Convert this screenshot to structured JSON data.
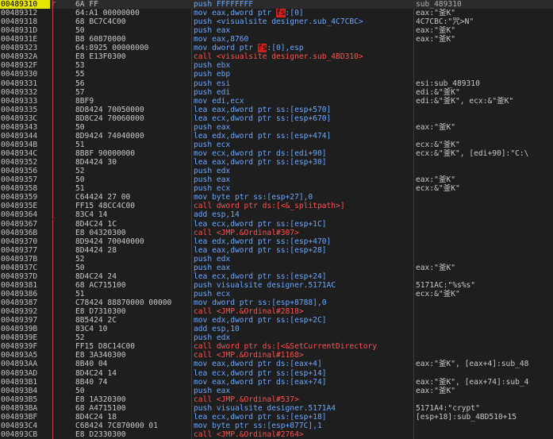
{
  "window": {
    "selected_address": "00489310",
    "function_label": "sub_489310"
  },
  "rows": [
    {
      "addr": "00489310",
      "mk": "tip",
      "bytes": "6A FF",
      "d": [
        [
          "b",
          "push FFFFFFFF"
        ]
      ],
      "cm": "sub_489310",
      "sel": true
    },
    {
      "addr": "00489312",
      "bytes": "64:A1 00000000",
      "d": [
        [
          "b",
          "mov eax,dword ptr "
        ],
        [
          "fs",
          "fs"
        ],
        [
          "b",
          ":[0]"
        ]
      ],
      "cm": "eax:\"釜K\""
    },
    {
      "addr": "00489318",
      "bytes": "68 BC7C4C00",
      "d": [
        [
          "b",
          "push <visualsite designer.sub_4C7CBC>"
        ]
      ],
      "cm": "4C7CBC:\"咒>N\""
    },
    {
      "addr": "0048931D",
      "bytes": "50",
      "d": [
        [
          "b",
          "push eax"
        ]
      ],
      "cm": "eax:\"釜K\""
    },
    {
      "addr": "0048931E",
      "bytes": "B8 60870000",
      "d": [
        [
          "b",
          "mov eax,8760"
        ]
      ],
      "cm": "eax:\"釜K\""
    },
    {
      "addr": "00489323",
      "bytes": "64:8925 00000000",
      "d": [
        [
          "b",
          "mov dword ptr "
        ],
        [
          "fs",
          "fs"
        ],
        [
          "b",
          ":[0],esp"
        ]
      ],
      "cm": ""
    },
    {
      "addr": "0048932A",
      "bytes": "E8 E13F0300",
      "d": [
        [
          "r",
          "call <visualsite designer.sub_4BD310>"
        ]
      ],
      "cm": ""
    },
    {
      "addr": "0048932F",
      "bytes": "53",
      "d": [
        [
          "b",
          "push ebx"
        ]
      ],
      "cm": ""
    },
    {
      "addr": "00489330",
      "bytes": "55",
      "d": [
        [
          "b",
          "push ebp"
        ]
      ],
      "cm": ""
    },
    {
      "addr": "00489331",
      "bytes": "56",
      "d": [
        [
          "b",
          "push esi"
        ]
      ],
      "cm": "esi:sub_489310"
    },
    {
      "addr": "00489332",
      "bytes": "57",
      "d": [
        [
          "b",
          "push edi"
        ]
      ],
      "cm": "edi:&\"釜K\""
    },
    {
      "addr": "00489333",
      "bytes": "8BF9",
      "d": [
        [
          "b",
          "mov edi,ecx"
        ]
      ],
      "cm": "edi:&\"釜K\", ecx:&\"釜K\""
    },
    {
      "addr": "00489335",
      "bytes": "8D8424 70050000",
      "d": [
        [
          "b",
          "lea eax,dword ptr ss:[esp+570]"
        ]
      ],
      "cm": ""
    },
    {
      "addr": "0048933C",
      "bytes": "8D8C24 70060000",
      "d": [
        [
          "b",
          "lea ecx,dword ptr ss:[esp+670]"
        ]
      ],
      "cm": ""
    },
    {
      "addr": "00489343",
      "bytes": "50",
      "d": [
        [
          "b",
          "push eax"
        ]
      ],
      "cm": "eax:\"釜K\""
    },
    {
      "addr": "00489344",
      "bytes": "8D9424 74040000",
      "d": [
        [
          "b",
          "lea edx,dword ptr ss:[esp+474]"
        ]
      ],
      "cm": ""
    },
    {
      "addr": "0048934B",
      "bytes": "51",
      "d": [
        [
          "b",
          "push ecx"
        ]
      ],
      "cm": "ecx:&\"釜K\""
    },
    {
      "addr": "0048934C",
      "bytes": "8B8F 90000000",
      "d": [
        [
          "b",
          "mov ecx,dword ptr ds:[edi+90]"
        ]
      ],
      "cm": "ecx:&\"釜K\", [edi+90]:\"C:\\"
    },
    {
      "addr": "00489352",
      "bytes": "8D4424 30",
      "d": [
        [
          "b",
          "lea eax,dword ptr ss:[esp+30]"
        ]
      ],
      "cm": ""
    },
    {
      "addr": "00489356",
      "bytes": "52",
      "d": [
        [
          "b",
          "push edx"
        ]
      ],
      "cm": ""
    },
    {
      "addr": "00489357",
      "bytes": "50",
      "d": [
        [
          "b",
          "push eax"
        ]
      ],
      "cm": "eax:\"釜K\""
    },
    {
      "addr": "00489358",
      "bytes": "51",
      "d": [
        [
          "b",
          "push ecx"
        ]
      ],
      "cm": "ecx:&\"釜K\""
    },
    {
      "addr": "00489359",
      "bytes": "C64424 27 00",
      "d": [
        [
          "b",
          "mov byte ptr ss:[esp+27],0"
        ]
      ],
      "cm": ""
    },
    {
      "addr": "0048935E",
      "bytes": "FF15 48CC4C00",
      "d": [
        [
          "r",
          "call dword ptr ds:[<&_splitpath>]"
        ]
      ],
      "cm": ""
    },
    {
      "addr": "00489364",
      "bytes": "83C4 14",
      "d": [
        [
          "b",
          "add esp,14"
        ]
      ],
      "cm": ""
    },
    {
      "addr": "00489367",
      "bytes": "8D4C24 1C",
      "d": [
        [
          "b",
          "lea ecx,dword ptr ss:[esp+1C]"
        ]
      ],
      "cm": ""
    },
    {
      "addr": "0048936B",
      "bytes": "E8 04320300",
      "d": [
        [
          "r",
          "call <JMP.&Ordinal#307>"
        ]
      ],
      "cm": ""
    },
    {
      "addr": "00489370",
      "bytes": "8D9424 70040000",
      "d": [
        [
          "b",
          "lea edx,dword ptr ss:[esp+470]"
        ]
      ],
      "cm": ""
    },
    {
      "addr": "00489377",
      "bytes": "8D4424 28",
      "d": [
        [
          "b",
          "lea eax,dword ptr ss:[esp+28]"
        ]
      ],
      "cm": ""
    },
    {
      "addr": "0048937B",
      "bytes": "52",
      "d": [
        [
          "b",
          "push edx"
        ]
      ],
      "cm": ""
    },
    {
      "addr": "0048937C",
      "bytes": "50",
      "d": [
        [
          "b",
          "push eax"
        ]
      ],
      "cm": "eax:\"釜K\""
    },
    {
      "addr": "0048937D",
      "bytes": "8D4C24 24",
      "d": [
        [
          "b",
          "lea ecx,dword ptr ss:[esp+24]"
        ]
      ],
      "cm": ""
    },
    {
      "addr": "00489381",
      "bytes": "68 AC715100",
      "d": [
        [
          "b",
          "push visualsite designer.5171AC"
        ]
      ],
      "cm": "5171AC:\"%s%s\""
    },
    {
      "addr": "00489386",
      "bytes": "51",
      "d": [
        [
          "b",
          "push ecx"
        ]
      ],
      "cm": "ecx:&\"釜K\""
    },
    {
      "addr": "00489387",
      "bytes": "C78424 88870000 00000",
      "d": [
        [
          "b",
          "mov dword ptr ss:[esp+8788],0"
        ]
      ],
      "cm": ""
    },
    {
      "addr": "00489392",
      "bytes": "E8 D7310300",
      "d": [
        [
          "r",
          "call <JMP.&Ordinal#2818>"
        ]
      ],
      "cm": ""
    },
    {
      "addr": "00489397",
      "bytes": "8B5424 2C",
      "d": [
        [
          "b",
          "mov edx,dword ptr ss:[esp+2C]"
        ]
      ],
      "cm": ""
    },
    {
      "addr": "0048939B",
      "bytes": "83C4 10",
      "d": [
        [
          "b",
          "add esp,10"
        ]
      ],
      "cm": ""
    },
    {
      "addr": "0048939E",
      "bytes": "52",
      "d": [
        [
          "b",
          "push edx"
        ]
      ],
      "cm": ""
    },
    {
      "addr": "0048939F",
      "bytes": "FF15 D8C14C00",
      "d": [
        [
          "r",
          "call dword ptr ds:[<&SetCurrentDirectory"
        ]
      ],
      "cm": ""
    },
    {
      "addr": "004893A5",
      "bytes": "E8 3A340300",
      "d": [
        [
          "r",
          "call <JMP.&Ordinal#1168>"
        ]
      ],
      "cm": ""
    },
    {
      "addr": "004893AA",
      "bytes": "8B40 04",
      "d": [
        [
          "b",
          "mov eax,dword ptr ds:[eax+4]"
        ]
      ],
      "cm": "eax:\"釜K\", [eax+4]:sub_48"
    },
    {
      "addr": "004893AD",
      "bytes": "8D4C24 14",
      "d": [
        [
          "b",
          "lea ecx,dword ptr ss:[esp+14]"
        ]
      ],
      "cm": ""
    },
    {
      "addr": "004893B1",
      "bytes": "8B40 74",
      "d": [
        [
          "b",
          "mov eax,dword ptr ds:[eax+74]"
        ]
      ],
      "cm": "eax:\"釜K\", [eax+74]:sub_4"
    },
    {
      "addr": "004893B4",
      "bytes": "50",
      "d": [
        [
          "b",
          "push eax"
        ]
      ],
      "cm": "eax:\"釜K\""
    },
    {
      "addr": "004893B5",
      "bytes": "E8 1A320300",
      "d": [
        [
          "r",
          "call <JMP.&Ordinal#537>"
        ]
      ],
      "cm": ""
    },
    {
      "addr": "004893BA",
      "bytes": "68 A4715100",
      "d": [
        [
          "b",
          "push visualsite designer.5171A4"
        ]
      ],
      "cm": "5171A4:\"crypt\""
    },
    {
      "addr": "004893BF",
      "bytes": "8D4C24 18",
      "d": [
        [
          "b",
          "lea ecx,dword ptr ss:[esp+18]"
        ]
      ],
      "cm": "[esp+18]:sub_4BD510+15"
    },
    {
      "addr": "004893C4",
      "bytes": "C68424 7C870000 01",
      "d": [
        [
          "b",
          "mov byte ptr ss:[esp+877C],1"
        ]
      ],
      "cm": ""
    },
    {
      "addr": "004893CB",
      "bytes": "E8 D2330300",
      "d": [
        [
          "r",
          "call <JMP.&Ordinal#2764>"
        ]
      ],
      "cm": ""
    }
  ]
}
